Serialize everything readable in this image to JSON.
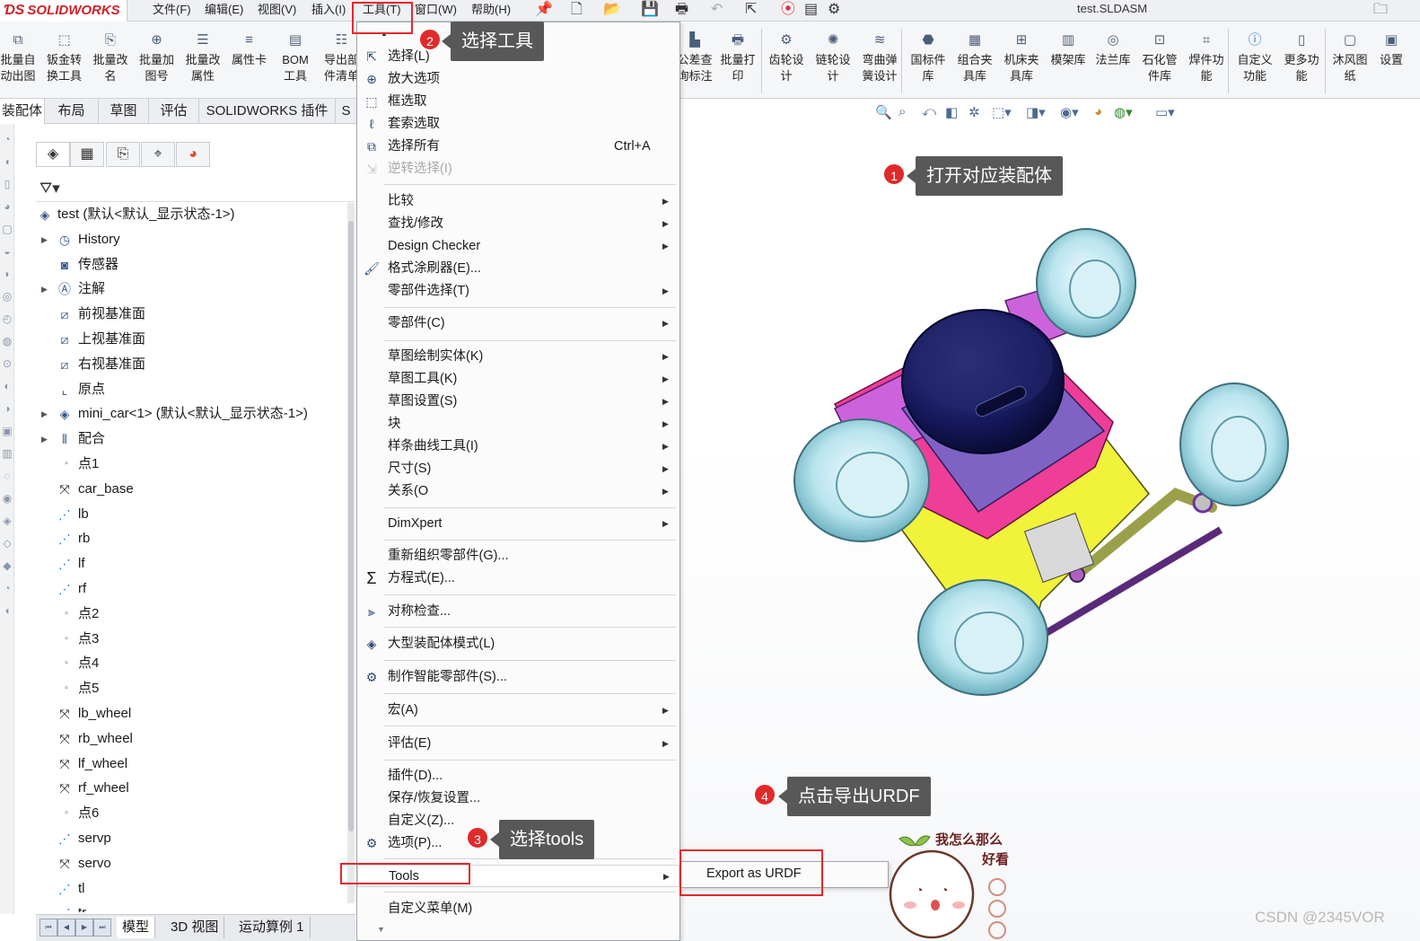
{
  "app": {
    "logo": "SOLIDWORKS",
    "document_title": "test.SLDASM"
  },
  "menubar": [
    "文件(F)",
    "编辑(E)",
    "视图(V)",
    "插入(I)",
    "工具(T)",
    "窗口(W)",
    "帮助(H)"
  ],
  "ribbon_left": [
    {
      "label": "批量自\n动出图",
      "icon": "drawing-icon"
    },
    {
      "label": "钣金转\n换工具",
      "icon": "sheet-metal-icon"
    },
    {
      "label": "批量改\n名",
      "icon": "rename-icon"
    },
    {
      "label": "批量加\n图号",
      "icon": "drawing-number-icon"
    },
    {
      "label": "批量改\n属性",
      "icon": "property-icon"
    },
    {
      "label": "属性卡",
      "icon": "property-card-icon"
    },
    {
      "label": "BOM\n工具",
      "icon": "bom-icon"
    },
    {
      "label": "导出部\n件清单",
      "icon": "export-list-icon"
    }
  ],
  "ribbon_right": [
    {
      "label": "公差查\n询标注",
      "icon": "tolerance-icon"
    },
    {
      "label": "批量打\n印",
      "icon": "print-icon"
    },
    {
      "label": "齿轮设\n计",
      "icon": "gear-design-icon"
    },
    {
      "label": "链轮设\n计",
      "icon": "sprocket-icon"
    },
    {
      "label": "弯曲弹\n簧设计",
      "icon": "spring-icon"
    },
    {
      "label": "国标件\n库",
      "icon": "standard-parts-icon"
    },
    {
      "label": "组合夹\n具库",
      "icon": "fixture-icon"
    },
    {
      "label": "机床夹\n具库",
      "icon": "machine-fixture-icon"
    },
    {
      "label": "模架库",
      "icon": "mold-base-icon"
    },
    {
      "label": "法兰库",
      "icon": "flange-icon"
    },
    {
      "label": "石化管\n件库",
      "icon": "pipe-icon"
    },
    {
      "label": "焊件功\n能",
      "icon": "weldment-icon"
    },
    {
      "label": "自定义\n功能",
      "icon": "info-icon"
    },
    {
      "label": "更多功\n能",
      "icon": "more-icon"
    },
    {
      "label": "沐风图\n纸",
      "icon": "paper-icon"
    },
    {
      "label": "设置",
      "icon": "settings-icon"
    }
  ],
  "tabs": [
    "装配体",
    "布局",
    "草图",
    "评估",
    "SOLIDWORKS 插件",
    "S"
  ],
  "tree": {
    "root": "test  (默认<默认_显示状态-1>)",
    "items": [
      {
        "label": "History",
        "icon": "history-icon",
        "expandable": true
      },
      {
        "label": "传感器",
        "icon": "sensor-icon",
        "expandable": false
      },
      {
        "label": "注解",
        "icon": "annotation-icon",
        "expandable": true
      },
      {
        "label": "前视基准面",
        "icon": "plane-icon",
        "expandable": false
      },
      {
        "label": "上视基准面",
        "icon": "plane-icon",
        "expandable": false
      },
      {
        "label": "右视基准面",
        "icon": "plane-icon",
        "expandable": false
      },
      {
        "label": "原点",
        "icon": "origin-icon",
        "expandable": false
      },
      {
        "label": "mini_car<1> (默认<默认_显示状态-1>)",
        "icon": "part-icon",
        "expandable": true
      },
      {
        "label": "配合",
        "icon": "mate-icon",
        "expandable": true
      },
      {
        "label": "点1",
        "icon": "point-icon",
        "expandable": false
      },
      {
        "label": "car_base",
        "icon": "coordinate-icon",
        "expandable": false
      },
      {
        "label": "lb",
        "icon": "axis-icon",
        "expandable": false
      },
      {
        "label": "rb",
        "icon": "axis-icon",
        "expandable": false
      },
      {
        "label": "lf",
        "icon": "axis-icon",
        "expandable": false
      },
      {
        "label": "rf",
        "icon": "axis-icon",
        "expandable": false
      },
      {
        "label": "点2",
        "icon": "point-icon",
        "expandable": false
      },
      {
        "label": "点3",
        "icon": "point-icon",
        "expandable": false
      },
      {
        "label": "点4",
        "icon": "point-icon",
        "expandable": false
      },
      {
        "label": "点5",
        "icon": "point-icon",
        "expandable": false
      },
      {
        "label": "lb_wheel",
        "icon": "coordinate-icon",
        "expandable": false
      },
      {
        "label": "rb_wheel",
        "icon": "coordinate-icon",
        "expandable": false
      },
      {
        "label": "lf_wheel",
        "icon": "coordinate-icon",
        "expandable": false
      },
      {
        "label": "rf_wheel",
        "icon": "coordinate-icon",
        "expandable": false
      },
      {
        "label": "点6",
        "icon": "point-icon",
        "expandable": false
      },
      {
        "label": "servp",
        "icon": "axis-icon",
        "expandable": false
      },
      {
        "label": "servo",
        "icon": "coordinate-icon",
        "expandable": false
      },
      {
        "label": "tl",
        "icon": "axis-icon",
        "expandable": false
      },
      {
        "label": "tr",
        "icon": "axis-icon",
        "expandable": false
      }
    ]
  },
  "bottom_tabs": [
    "模型",
    "3D 视图",
    "运动算例 1"
  ],
  "tools_menu": [
    {
      "label": "选择(L)",
      "icon": "select-icon",
      "shortcut": "",
      "submenu": false,
      "disabled": false
    },
    {
      "label": "放大选项",
      "icon": "zoom-select-icon",
      "shortcut": "",
      "submenu": false,
      "disabled": false
    },
    {
      "label": "框选取",
      "icon": "box-select-icon",
      "shortcut": "",
      "submenu": false,
      "disabled": false
    },
    {
      "label": "套索选取",
      "icon": "lasso-icon",
      "shortcut": "",
      "submenu": false,
      "disabled": false
    },
    {
      "label": "选择所有",
      "icon": "select-all-icon",
      "shortcut": "Ctrl+A",
      "submenu": false,
      "disabled": false
    },
    {
      "label": "逆转选择(I)",
      "icon": "invert-select-icon",
      "shortcut": "",
      "submenu": false,
      "disabled": true
    },
    {
      "label": "比较",
      "icon": "",
      "shortcut": "",
      "submenu": true,
      "disabled": false
    },
    {
      "label": "查找/修改",
      "icon": "",
      "shortcut": "",
      "submenu": true,
      "disabled": false
    },
    {
      "label": "Design Checker",
      "icon": "",
      "shortcut": "",
      "submenu": true,
      "disabled": false
    },
    {
      "label": "格式涂刷器(E)...",
      "icon": "brush-icon",
      "shortcut": "",
      "submenu": false,
      "disabled": false
    },
    {
      "label": "零部件选择(T)",
      "icon": "",
      "shortcut": "",
      "submenu": true,
      "disabled": false
    },
    {
      "label": "零部件(C)",
      "icon": "",
      "shortcut": "",
      "submenu": true,
      "disabled": false
    },
    {
      "label": "草图绘制实体(K)",
      "icon": "",
      "shortcut": "",
      "submenu": true,
      "disabled": false
    },
    {
      "label": "草图工具(K)",
      "icon": "",
      "shortcut": "",
      "submenu": true,
      "disabled": false
    },
    {
      "label": "草图设置(S)",
      "icon": "",
      "shortcut": "",
      "submenu": true,
      "disabled": false
    },
    {
      "label": "块",
      "icon": "",
      "shortcut": "",
      "submenu": true,
      "disabled": false
    },
    {
      "label": "样条曲线工具(I)",
      "icon": "",
      "shortcut": "",
      "submenu": true,
      "disabled": false
    },
    {
      "label": "尺寸(S)",
      "icon": "",
      "shortcut": "",
      "submenu": true,
      "disabled": false
    },
    {
      "label": "关系(O",
      "icon": "",
      "shortcut": "",
      "submenu": true,
      "disabled": false
    },
    {
      "label": "DimXpert",
      "icon": "",
      "shortcut": "",
      "submenu": true,
      "disabled": false
    },
    {
      "label": "重新组织零部件(G)...",
      "icon": "",
      "shortcut": "",
      "submenu": false,
      "disabled": false
    },
    {
      "label": "方程式(E)...",
      "icon": "sigma-icon",
      "shortcut": "",
      "submenu": false,
      "disabled": false
    },
    {
      "label": "对称检查...",
      "icon": "symmetry-icon",
      "shortcut": "",
      "submenu": false,
      "disabled": false
    },
    {
      "label": "大型装配体模式(L)",
      "icon": "large-assembly-icon",
      "shortcut": "",
      "submenu": false,
      "disabled": false
    },
    {
      "label": "制作智能零部件(S)...",
      "icon": "smart-component-icon",
      "shortcut": "",
      "submenu": false,
      "disabled": false
    },
    {
      "label": "宏(A)",
      "icon": "",
      "shortcut": "",
      "submenu": true,
      "disabled": false
    },
    {
      "label": "评估(E)",
      "icon": "",
      "shortcut": "",
      "submenu": true,
      "disabled": false
    },
    {
      "label": "插件(D)...",
      "icon": "",
      "shortcut": "",
      "submenu": false,
      "disabled": false
    },
    {
      "label": "保存/恢复设置...",
      "icon": "",
      "shortcut": "",
      "submenu": false,
      "disabled": false
    },
    {
      "label": "自定义(Z)...",
      "icon": "",
      "shortcut": "",
      "submenu": false,
      "disabled": false
    },
    {
      "label": "选项(P)...",
      "icon": "gear-icon",
      "shortcut": "",
      "submenu": false,
      "disabled": false
    },
    {
      "label": "Tools",
      "icon": "",
      "shortcut": "",
      "submenu": true,
      "disabled": false
    },
    {
      "label": "自定义菜单(M)",
      "icon": "",
      "shortcut": "",
      "submenu": false,
      "disabled": false
    }
  ],
  "submenu": {
    "export_label": "Export as URDF"
  },
  "annotations": [
    {
      "num": "1",
      "text": "打开对应装配体"
    },
    {
      "num": "2",
      "text": "选择工具"
    },
    {
      "num": "3",
      "text": "选择tools"
    },
    {
      "num": "4",
      "text": "点击导出URDF"
    }
  ],
  "sticker_text": [
    "我怎么那么",
    "好看"
  ],
  "watermark": "CSDN @2345VOR",
  "colors": {
    "accent_red": "#e8262b",
    "callout_bg": "#585858",
    "logo_red": "#d1202a"
  }
}
